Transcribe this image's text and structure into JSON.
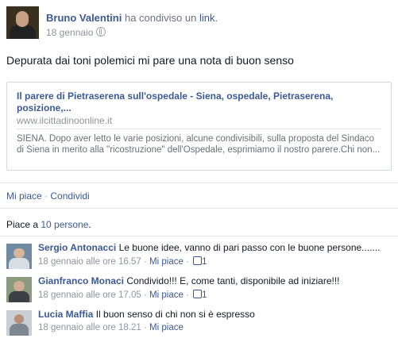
{
  "header": {
    "author": "Bruno Valentini",
    "action_text": "ha condiviso un",
    "action_link": "link",
    "action_end": ".",
    "date": "18 gennaio"
  },
  "status_text": "Depurata dai toni polemici mi pare una nota di buon senso",
  "share": {
    "title": "Il parere di Pietraserena sull'ospedale - Siena, ospedale, Pietraserena, posizione,...",
    "domain": "www.ilcittadinoonline.it",
    "description": "SIENA. Dopo aver letto le varie posizioni, alcune condivisibili, sulla proposta del Sindaco di Siena in merito alla \"ricostruzione\" dell'Ospedale, esprimiamo il nostro parere.Chi non..."
  },
  "actions": {
    "like": "Mi piace",
    "separator": " · ",
    "share": "Condividi"
  },
  "likes": {
    "prefix": "Piace a ",
    "count_link": "10 persone",
    "suffix": "."
  },
  "comments": [
    {
      "author": "Sergio Antonacci",
      "text": "Le buone idee, vanno di pari passo con le buone persone.......",
      "time": "18 gennaio alle ore 16.57",
      "like_label": "Mi piace",
      "like_count": "1",
      "separator": " · "
    },
    {
      "author": "Gianfranco Monaci",
      "text": "Condivido!!! E, come tanti, disponibile ad iniziare!!!",
      "time": "18 gennaio alle ore 17.05",
      "like_label": "Mi piace",
      "like_count": "1",
      "separator": " · "
    },
    {
      "author": "Lucia Maffia",
      "text": "Il buon senso di chi non si è espresso",
      "time": "18 gennaio alle ore 18.21",
      "like_label": "Mi piace",
      "separator": " · "
    }
  ],
  "colors": {
    "link": "#3b5998",
    "muted": "#90949c",
    "border": "#d3d6db"
  }
}
